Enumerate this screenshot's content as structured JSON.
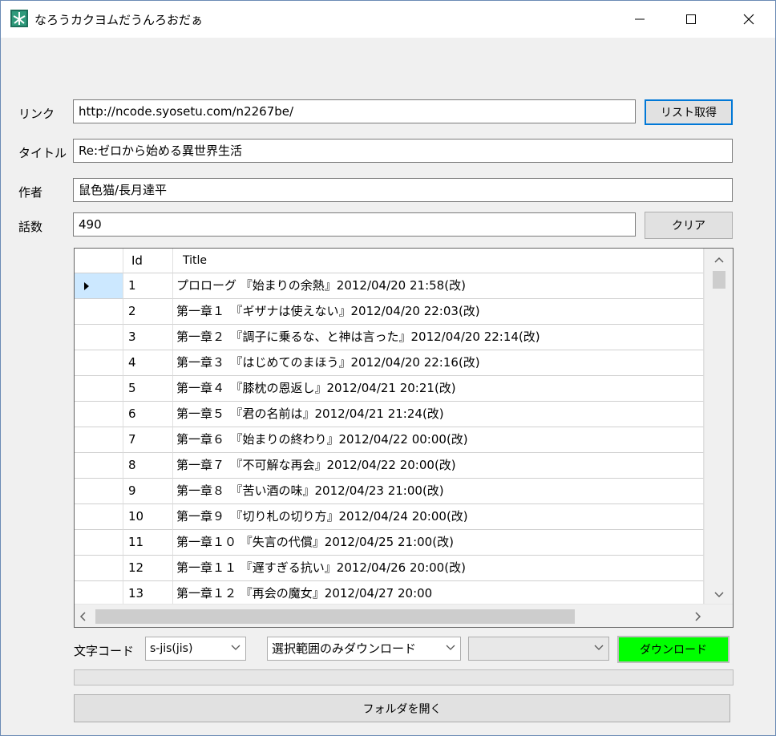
{
  "window": {
    "title": "なろうカクヨムだうんろおだぁ"
  },
  "form": {
    "link_label": "リンク",
    "link_value": "http://ncode.syosetu.com/n2267be/",
    "get_list_button": "リスト取得",
    "title_label": "タイトル",
    "title_value": "Re:ゼロから始める異世界生活",
    "author_label": "作者",
    "author_value": "鼠色猫/長月達平",
    "count_label": "話数",
    "count_value": "490",
    "clear_button": "クリア"
  },
  "grid": {
    "columns": [
      "Id",
      "Title"
    ],
    "rows": [
      {
        "id": "1",
        "title": "プロローグ 『始まりの余熱』2012/04/20 21:58(改)"
      },
      {
        "id": "2",
        "title": "第一章１　『ギザナは使えない』2012/04/20 22:03(改)"
      },
      {
        "id": "3",
        "title": "第一章２　『調子に乗るな、と神は言った』2012/04/20 22:14(改)"
      },
      {
        "id": "4",
        "title": "第一章３　『はじめてのまほう』2012/04/20 22:16(改)"
      },
      {
        "id": "5",
        "title": "第一章４　『膝枕の恩返し』2012/04/21 20:21(改)"
      },
      {
        "id": "6",
        "title": "第一章５　『君の名前は』2012/04/21 21:24(改)"
      },
      {
        "id": "7",
        "title": "第一章６　『始まりの終わり』2012/04/22 00:00(改)"
      },
      {
        "id": "8",
        "title": "第一章７　『不可解な再会』2012/04/22 20:00(改)"
      },
      {
        "id": "9",
        "title": "第一章８　『苦い酒の味』2012/04/23 21:00(改)"
      },
      {
        "id": "10",
        "title": "第一章９　『切り札の切り方』2012/04/24 20:00(改)"
      },
      {
        "id": "11",
        "title": "第一章１０ 『失言の代償』2012/04/25 21:00(改)"
      },
      {
        "id": "12",
        "title": "第一章１１ 『遅すぎる抗い』2012/04/26 20:00(改)"
      },
      {
        "id": "13",
        "title": "第一章１２ 『再会の魔女』2012/04/27 20:00"
      }
    ]
  },
  "bottom": {
    "encoding_label": "文字コード",
    "encoding_value": "s-jis(jis)",
    "range_value": "選択範囲のみダウンロード",
    "extra_value": "",
    "download_button": "ダウンロード",
    "open_folder_button": "フォルダを開く"
  },
  "colors": {
    "download_bg": "#00ff00",
    "accent": "#0078d7",
    "selected_row_header": "#cce8ff"
  }
}
